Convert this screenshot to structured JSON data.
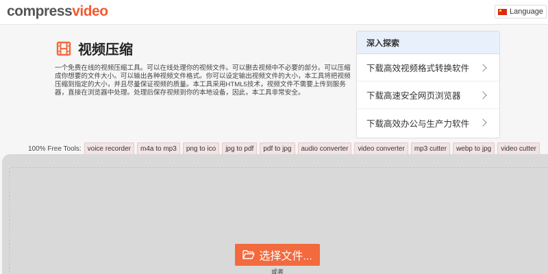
{
  "header": {
    "logo_part1": "compress",
    "logo_part2": "video",
    "language_label": "Language"
  },
  "main": {
    "title": "视频压缩",
    "description": "一个免费在线的视频压缩工具。可以在线处理你的视频文件。可以删去视频中不必要的部分。可以压缩成你想要的文件大小。可以输出各种视频文件格式。你可以设定输出视频文件的大小，本工具将把视频压缩到指定的大小，并且尽量保证视频的质量。本工具采用HTML5技术，视频文件不需要上传到服务器，直接在浏览器中处理。处理后保存视频到你的本地设备，因此，本工具非常安全。"
  },
  "explore": {
    "heading": "深入探索",
    "items": [
      "下载高效视频格式转换软件",
      "下载高速安全网页浏览器",
      "下载高效办公与生产力软件"
    ]
  },
  "tools": {
    "label": "100% Free Tools:",
    "items": [
      "voice recorder",
      "m4a to mp3",
      "png to ico",
      "jpg to pdf",
      "pdf to jpg",
      "audio converter",
      "video converter",
      "mp3 cutter",
      "webp to jpg",
      "video cutter"
    ]
  },
  "upload": {
    "button_label": "选择文件...",
    "or_label": "或者"
  },
  "colors": {
    "accent": "#f26a3d",
    "logo_gray": "#555555",
    "logo_orange": "#f15a31"
  }
}
